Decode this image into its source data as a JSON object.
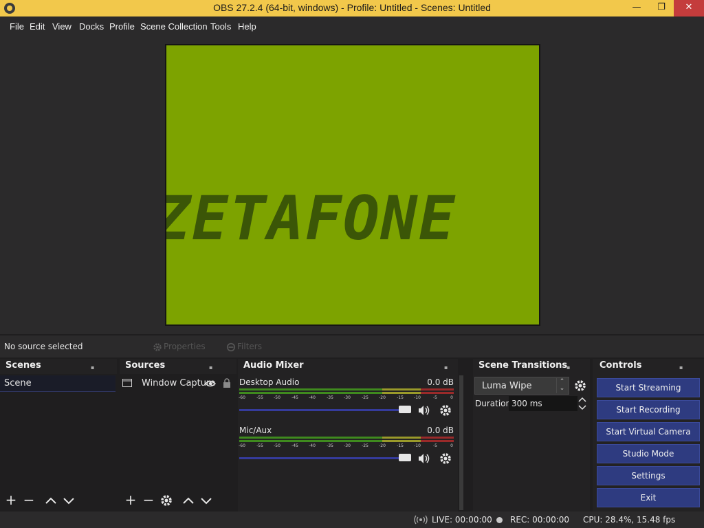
{
  "window": {
    "title": "OBS 27.2.4 (64-bit, windows) - Profile: Untitled - Scenes: Untitled",
    "min": "—",
    "max": "❐",
    "close": "✕"
  },
  "menu": [
    "File",
    "Edit",
    "View",
    "Docks",
    "Profile",
    "Scene Collection",
    "Tools",
    "Help"
  ],
  "preview": {
    "text": "ZETAFONE",
    "canvas_color": "#7da300"
  },
  "context_bar": {
    "status": "No source selected",
    "properties": "Properties",
    "filters": "Filters"
  },
  "scenes": {
    "title": "Scenes",
    "items": [
      "Scene"
    ]
  },
  "sources": {
    "title": "Sources",
    "items": [
      {
        "name": "Window Capture",
        "visible": true,
        "locked": false
      }
    ]
  },
  "audio_mixer": {
    "title": "Audio Mixer",
    "ticks": [
      "-60",
      "-55",
      "-50",
      "-45",
      "-40",
      "-35",
      "-30",
      "-25",
      "-20",
      "-15",
      "-10",
      "-5",
      "0"
    ],
    "channels": [
      {
        "name": "Desktop Audio",
        "db": "0.0 dB",
        "volume": 1.0
      },
      {
        "name": "Mic/Aux",
        "db": "0.0 dB",
        "volume": 1.0
      }
    ]
  },
  "transitions": {
    "title": "Scene Transitions",
    "selected": "Luma Wipe",
    "duration_label": "Duration",
    "duration_value": "300 ms"
  },
  "controls": {
    "title": "Controls",
    "buttons": [
      "Start Streaming",
      "Start Recording",
      "Start Virtual Camera",
      "Studio Mode",
      "Settings",
      "Exit"
    ]
  },
  "status": {
    "live": "LIVE: 00:00:00",
    "rec": "REC: 00:00:00",
    "cpu": "CPU: 28.4%, 15.48 fps"
  },
  "colors": {
    "accent": "#2e3b80",
    "titlebar": "#f2c84b",
    "meter_green": "#3f8a1e",
    "meter_yellow": "#9a9a2a",
    "meter_red": "#9a2a2a"
  }
}
